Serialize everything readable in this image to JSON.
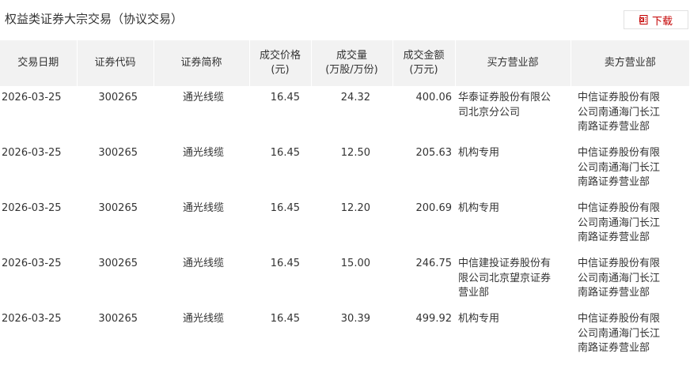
{
  "header": {
    "title": "权益类证券大宗交易（协议交易）",
    "download_label": "下载",
    "accent_color": "#c40000"
  },
  "table": {
    "columns": [
      [
        "交易日期"
      ],
      [
        "证券代码"
      ],
      [
        "证券简称"
      ],
      [
        "成交价格",
        "(元)"
      ],
      [
        "成交量",
        "(万股/万份)"
      ],
      [
        "成交金额",
        "(万元)"
      ],
      [
        "买方营业部"
      ],
      [
        "卖方营业部"
      ]
    ],
    "rows": [
      {
        "date": "2026-03-25",
        "code": "300265",
        "name": "通光线缆",
        "price": "16.45",
        "volume": "24.32",
        "amount": "400.06",
        "buyer": "华泰证券股份有限公司北京分公司",
        "seller": "中信证券股份有限公司南通海门长江南路证券营业部"
      },
      {
        "date": "2026-03-25",
        "code": "300265",
        "name": "通光线缆",
        "price": "16.45",
        "volume": "12.50",
        "amount": "205.63",
        "buyer": "机构专用",
        "seller": "中信证券股份有限公司南通海门长江南路证券营业部"
      },
      {
        "date": "2026-03-25",
        "code": "300265",
        "name": "通光线缆",
        "price": "16.45",
        "volume": "12.20",
        "amount": "200.69",
        "buyer": "机构专用",
        "seller": "中信证券股份有限公司南通海门长江南路证券营业部"
      },
      {
        "date": "2026-03-25",
        "code": "300265",
        "name": "通光线缆",
        "price": "16.45",
        "volume": "15.00",
        "amount": "246.75",
        "buyer": "中信建投证券股份有限公司北京望京证券营业部",
        "seller": "中信证券股份有限公司南通海门长江南路证券营业部"
      },
      {
        "date": "2026-03-25",
        "code": "300265",
        "name": "通光线缆",
        "price": "16.45",
        "volume": "30.39",
        "amount": "499.92",
        "buyer": "机构专用",
        "seller": "中信证券股份有限公司南通海门长江南路证券营业部"
      }
    ]
  }
}
